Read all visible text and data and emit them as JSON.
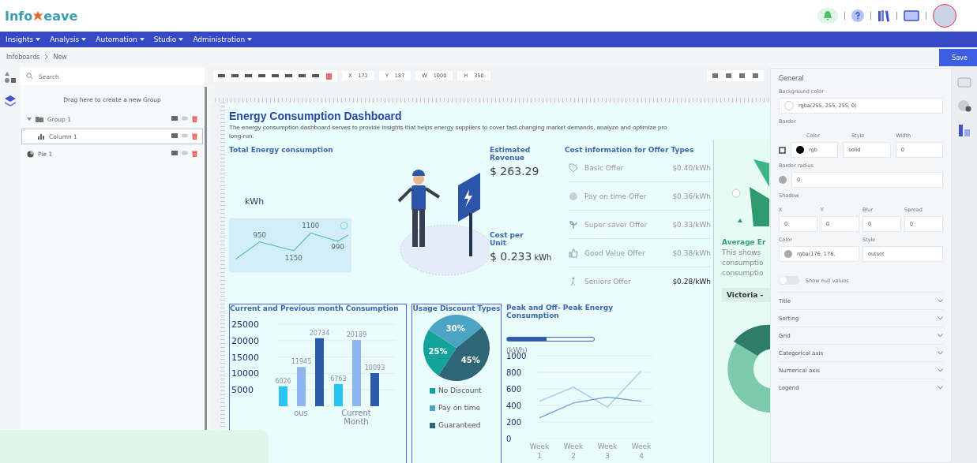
{
  "header": {
    "logo": [
      "Info",
      "eave"
    ]
  },
  "nav": [
    {
      "label": "Insights"
    },
    {
      "label": "Analysis"
    },
    {
      "label": "Automation"
    },
    {
      "label": "Studio"
    },
    {
      "label": "Administration"
    }
  ],
  "breadcrumb": [
    "Infoboards",
    "New"
  ],
  "save_button": "Save",
  "layers_panel": {
    "search_placeholder": "Search",
    "drop_hint": "Drag here to create a new Group",
    "tree": [
      {
        "label": "Group 1",
        "kind": "group",
        "expanded": true,
        "selected": false,
        "children": [
          {
            "label": "Column 1",
            "kind": "column",
            "selected": true
          }
        ]
      },
      {
        "label": "Pie 1",
        "kind": "pie",
        "selected": false
      }
    ]
  },
  "toolbar": {
    "fields": [
      {
        "label": "X",
        "value": "172"
      },
      {
        "label": "Y",
        "value": "187"
      },
      {
        "label": "W",
        "value": "1000"
      },
      {
        "label": "H",
        "value": "350"
      }
    ]
  },
  "dashboard": {
    "title": "Energy Consumption Dashboard",
    "description": [
      "The energy consumption dashboard serves to provide insights that helps energy suppliers to cover fast-changing market demands, analyze and optimize pro",
      "long-run."
    ],
    "total_energy": {
      "title": "Total Energy consumption",
      "unit": "kWh",
      "sparkline_labels": [
        "950",
        "1150",
        "1100",
        "990"
      ]
    },
    "revenue": {
      "title": "Estimated Revenue",
      "value": "$ 263.29"
    },
    "cost_per_unit": {
      "title": "Cost per Unit",
      "value": "$ 0.233",
      "unit": "kWh"
    },
    "offers": {
      "title": "Cost information for Offer Types",
      "rows": [
        {
          "name": "Basic Offer",
          "price": "$0.40/kWh"
        },
        {
          "name": "Pay on time Offer",
          "price": "$0.36/kWh"
        },
        {
          "name": "Super saver Offer",
          "price": "$0.33/kWh"
        },
        {
          "name": "Good Value Offer",
          "price": "$0.38/kWh"
        },
        {
          "name": "Seniors Offer",
          "price": "$0.28/kWh"
        }
      ]
    },
    "monthly": {
      "title": "Current and Previous month Consumption",
      "chart_data": {
        "type": "bar",
        "categories": [
          "ous",
          "Current Month"
        ],
        "yticks": [
          5000,
          10000,
          15000,
          20000,
          25000
        ],
        "ylim": [
          0,
          25000
        ],
        "grid": true,
        "data_labels": true,
        "series": [
          {
            "color": "#29c4f4",
            "values": [
              6026,
              6763
            ]
          },
          {
            "color": "#8db6ef",
            "values": [
              11945,
              20189
            ]
          },
          {
            "color": "#2b5ba8",
            "values": [
              20734,
              10093
            ]
          }
        ]
      }
    },
    "discount": {
      "title": "Usage Discount Types",
      "chart_data": {
        "type": "pie",
        "categories": [
          "No Discount",
          "Pay on time",
          "Guaranteed"
        ],
        "value_labels": [
          "25%",
          "30%",
          "45%"
        ],
        "series": [
          {
            "colors": [
              "#14a39a",
              "#4ba4c4",
              "#2e6678"
            ],
            "values": [
              25,
              30,
              45
            ]
          }
        ]
      }
    },
    "peak": {
      "title": "Peak and Off- Peak Energy Consumption",
      "range": {
        "level": 0.45
      },
      "chart_data": {
        "type": "line",
        "ylabel": "(kWh)",
        "categories": [
          "Week 1",
          "Week 2",
          "Week 3",
          "Week 4"
        ],
        "yticks": [
          0,
          200,
          400,
          600,
          800,
          1000
        ],
        "ylim": [
          0,
          1000
        ],
        "grid": true,
        "series": [
          {
            "color": "#a8d0ea",
            "values": [
              450,
              620,
              380,
              820
            ]
          },
          {
            "color": "#7ea9d3",
            "values": [
              250,
              430,
              500,
              450
            ]
          }
        ]
      }
    },
    "side": {
      "title": "Average Er",
      "lines": [
        "This shows",
        "consumptio",
        "consumptio"
      ],
      "chip": "Victoria -"
    }
  },
  "properties": {
    "section": "General",
    "background_label": "Background color",
    "background_value": "rgba(255, 255, 255, 0)",
    "border_label": "Border",
    "border_cols": [
      "Color",
      "Style",
      "Width"
    ],
    "border_values": [
      "rgb",
      "solid",
      "0"
    ],
    "radius_label": "Border radius",
    "radius_value": "0",
    "shadow_label": "Shadow",
    "shadow_fields": [
      {
        "label": "X",
        "value": "0"
      },
      {
        "label": "Y",
        "value": "0"
      },
      {
        "label": "Blur",
        "value": "0"
      },
      {
        "label": "Spread",
        "value": "0"
      }
    ],
    "shadow_color_label": "Color",
    "shadow_color": "rgba(176, 176,",
    "shadow_style_label": "Style",
    "shadow_style": "outset",
    "null_toggle": {
      "label": "Show null values",
      "on": false
    },
    "sections": [
      {
        "label": "Title",
        "expanded": false
      },
      {
        "label": "Sorting",
        "expanded": false
      },
      {
        "label": "Grid",
        "expanded": false
      },
      {
        "label": "Categorical axis",
        "expanded": false
      },
      {
        "label": "Numerical axis",
        "expanded": false
      },
      {
        "label": "Legend",
        "expanded": false
      }
    ]
  }
}
